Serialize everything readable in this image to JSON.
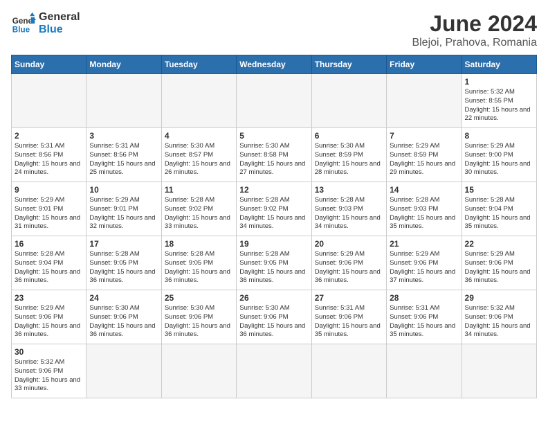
{
  "header": {
    "logo_general": "General",
    "logo_blue": "Blue",
    "month_year": "June 2024",
    "location": "Blejoi, Prahova, Romania"
  },
  "days_of_week": [
    "Sunday",
    "Monday",
    "Tuesday",
    "Wednesday",
    "Thursday",
    "Friday",
    "Saturday"
  ],
  "weeks": [
    [
      {
        "day": "",
        "info": ""
      },
      {
        "day": "",
        "info": ""
      },
      {
        "day": "",
        "info": ""
      },
      {
        "day": "",
        "info": ""
      },
      {
        "day": "",
        "info": ""
      },
      {
        "day": "",
        "info": ""
      },
      {
        "day": "1",
        "info": "Sunrise: 5:32 AM\nSunset: 8:55 PM\nDaylight: 15 hours and 22 minutes."
      }
    ],
    [
      {
        "day": "2",
        "info": "Sunrise: 5:31 AM\nSunset: 8:56 PM\nDaylight: 15 hours and 24 minutes."
      },
      {
        "day": "3",
        "info": "Sunrise: 5:31 AM\nSunset: 8:56 PM\nDaylight: 15 hours and 25 minutes."
      },
      {
        "day": "4",
        "info": "Sunrise: 5:30 AM\nSunset: 8:57 PM\nDaylight: 15 hours and 26 minutes."
      },
      {
        "day": "5",
        "info": "Sunrise: 5:30 AM\nSunset: 8:58 PM\nDaylight: 15 hours and 27 minutes."
      },
      {
        "day": "6",
        "info": "Sunrise: 5:30 AM\nSunset: 8:59 PM\nDaylight: 15 hours and 28 minutes."
      },
      {
        "day": "7",
        "info": "Sunrise: 5:29 AM\nSunset: 8:59 PM\nDaylight: 15 hours and 29 minutes."
      },
      {
        "day": "8",
        "info": "Sunrise: 5:29 AM\nSunset: 9:00 PM\nDaylight: 15 hours and 30 minutes."
      }
    ],
    [
      {
        "day": "9",
        "info": "Sunrise: 5:29 AM\nSunset: 9:01 PM\nDaylight: 15 hours and 31 minutes."
      },
      {
        "day": "10",
        "info": "Sunrise: 5:29 AM\nSunset: 9:01 PM\nDaylight: 15 hours and 32 minutes."
      },
      {
        "day": "11",
        "info": "Sunrise: 5:28 AM\nSunset: 9:02 PM\nDaylight: 15 hours and 33 minutes."
      },
      {
        "day": "12",
        "info": "Sunrise: 5:28 AM\nSunset: 9:02 PM\nDaylight: 15 hours and 34 minutes."
      },
      {
        "day": "13",
        "info": "Sunrise: 5:28 AM\nSunset: 9:03 PM\nDaylight: 15 hours and 34 minutes."
      },
      {
        "day": "14",
        "info": "Sunrise: 5:28 AM\nSunset: 9:03 PM\nDaylight: 15 hours and 35 minutes."
      },
      {
        "day": "15",
        "info": "Sunrise: 5:28 AM\nSunset: 9:04 PM\nDaylight: 15 hours and 35 minutes."
      }
    ],
    [
      {
        "day": "16",
        "info": "Sunrise: 5:28 AM\nSunset: 9:04 PM\nDaylight: 15 hours and 36 minutes."
      },
      {
        "day": "17",
        "info": "Sunrise: 5:28 AM\nSunset: 9:05 PM\nDaylight: 15 hours and 36 minutes."
      },
      {
        "day": "18",
        "info": "Sunrise: 5:28 AM\nSunset: 9:05 PM\nDaylight: 15 hours and 36 minutes."
      },
      {
        "day": "19",
        "info": "Sunrise: 5:28 AM\nSunset: 9:05 PM\nDaylight: 15 hours and 36 minutes."
      },
      {
        "day": "20",
        "info": "Sunrise: 5:29 AM\nSunset: 9:06 PM\nDaylight: 15 hours and 36 minutes."
      },
      {
        "day": "21",
        "info": "Sunrise: 5:29 AM\nSunset: 9:06 PM\nDaylight: 15 hours and 37 minutes."
      },
      {
        "day": "22",
        "info": "Sunrise: 5:29 AM\nSunset: 9:06 PM\nDaylight: 15 hours and 36 minutes."
      }
    ],
    [
      {
        "day": "23",
        "info": "Sunrise: 5:29 AM\nSunset: 9:06 PM\nDaylight: 15 hours and 36 minutes."
      },
      {
        "day": "24",
        "info": "Sunrise: 5:30 AM\nSunset: 9:06 PM\nDaylight: 15 hours and 36 minutes."
      },
      {
        "day": "25",
        "info": "Sunrise: 5:30 AM\nSunset: 9:06 PM\nDaylight: 15 hours and 36 minutes."
      },
      {
        "day": "26",
        "info": "Sunrise: 5:30 AM\nSunset: 9:06 PM\nDaylight: 15 hours and 36 minutes."
      },
      {
        "day": "27",
        "info": "Sunrise: 5:31 AM\nSunset: 9:06 PM\nDaylight: 15 hours and 35 minutes."
      },
      {
        "day": "28",
        "info": "Sunrise: 5:31 AM\nSunset: 9:06 PM\nDaylight: 15 hours and 35 minutes."
      },
      {
        "day": "29",
        "info": "Sunrise: 5:32 AM\nSunset: 9:06 PM\nDaylight: 15 hours and 34 minutes."
      }
    ],
    [
      {
        "day": "30",
        "info": "Sunrise: 5:32 AM\nSunset: 9:06 PM\nDaylight: 15 hours and 33 minutes."
      },
      {
        "day": "",
        "info": ""
      },
      {
        "day": "",
        "info": ""
      },
      {
        "day": "",
        "info": ""
      },
      {
        "day": "",
        "info": ""
      },
      {
        "day": "",
        "info": ""
      },
      {
        "day": "",
        "info": ""
      }
    ]
  ]
}
